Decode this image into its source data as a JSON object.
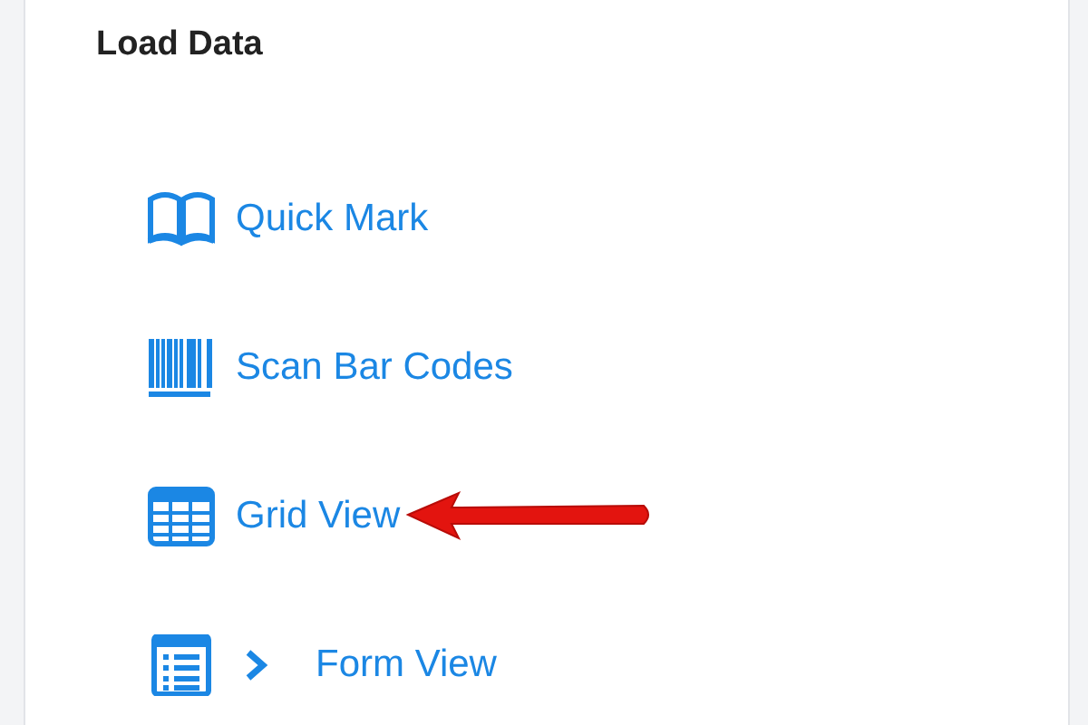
{
  "panel": {
    "title": "Load Data",
    "items": [
      {
        "label": "Quick Mark",
        "pointed": false
      },
      {
        "label": "Scan Bar Codes",
        "pointed": false
      },
      {
        "label": "Grid View",
        "pointed": true
      },
      {
        "label": "Form View",
        "pointed": false,
        "expanded": false
      }
    ]
  }
}
